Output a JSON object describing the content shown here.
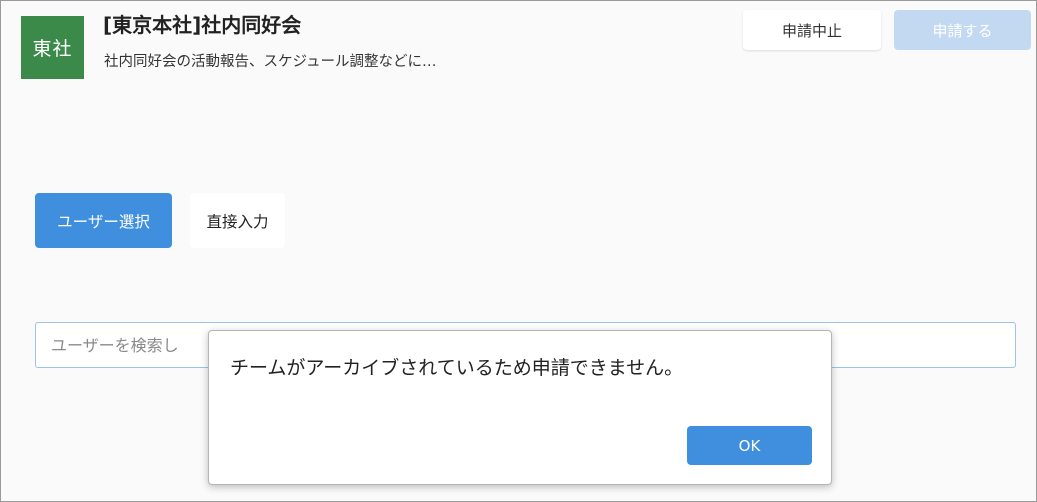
{
  "team": {
    "avatar_text": "東社",
    "title": "[東京本社]社内同好会",
    "description": "社内同好会の活動報告、スケジュール調整などに…"
  },
  "actions": {
    "cancel_apply_label": "申請中止",
    "apply_label": "申請する"
  },
  "tabs": [
    {
      "label": "ユーザー選択",
      "selected": true
    },
    {
      "label": "直接入力",
      "selected": false
    }
  ],
  "search": {
    "placeholder": "ユーザーを検索し",
    "value": ""
  },
  "dialog": {
    "message": "チームがアーカイブされているため申請できません。",
    "ok_label": "OK"
  },
  "colors": {
    "avatar_bg": "#3c8a4a",
    "primary": "#3f8fde",
    "primary_disabled": "#c3d9f1",
    "page_bg": "#fafafa"
  }
}
